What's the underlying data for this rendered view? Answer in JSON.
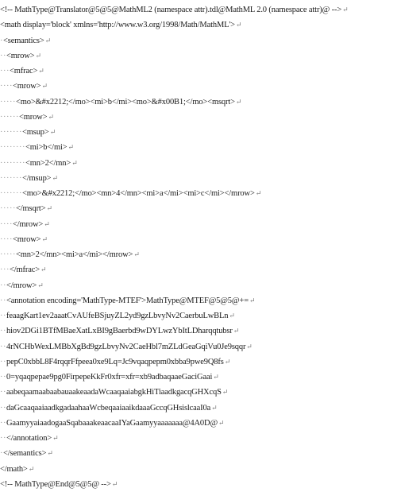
{
  "lines": [
    {
      "indent": "",
      "text": "<!-- MathType@Translator@5@5@MathML2 (namespace attr).tdl@MathML 2.0 (namespace attr)@ -->"
    },
    {
      "indent": "",
      "text": "<math display='block' xmlns='http://www.w3.org/1998/Math/MathML'>"
    },
    {
      "indent": "·",
      "text": "<semantics>"
    },
    {
      "indent": "··",
      "text": "<mrow>"
    },
    {
      "indent": "···",
      "text": "<mfrac>"
    },
    {
      "indent": "····",
      "text": "<mrow>"
    },
    {
      "indent": "·····",
      "text": "<mo>&#x2212;</mo><mi>b</mi><mo>&#x00B1;</mo><msqrt>"
    },
    {
      "indent": "······",
      "text": "<mrow>"
    },
    {
      "indent": "·······",
      "text": "<msup>"
    },
    {
      "indent": "········",
      "text": "<mi>b</mi>"
    },
    {
      "indent": "········",
      "text": "<mn>2</mn>"
    },
    {
      "indent": "·······",
      "text": "</msup>"
    },
    {
      "indent": "·······",
      "text": "<mo>&#x2212;</mo><mn>4</mn><mi>a</mi><mi>c</mi></mrow>"
    },
    {
      "indent": "·····",
      "text": "</msqrt>"
    },
    {
      "indent": "····",
      "text": "</mrow>"
    },
    {
      "indent": "····",
      "text": "<mrow>"
    },
    {
      "indent": "·····",
      "text": "<mn>2</mn><mi>a</mi></mrow>"
    },
    {
      "indent": "···",
      "text": "</mfrac>"
    },
    {
      "indent": "··",
      "text": "</mrow>"
    },
    {
      "indent": "··",
      "text": "<annotation encoding='MathType-MTEF'>MathType@MTEF@5@5@+="
    },
    {
      "indent": "··",
      "text": "feaagKart1ev2aaatCvAUfeBSjuyZL2yd9gzLbvyNv2CaerbuLwBLn"
    },
    {
      "indent": "··",
      "text": "hiov2DGi1BTfMBaeXatLxBI9gBaerbd9wDYLwzYbItLDharqqtubsr"
    },
    {
      "indent": "··",
      "text": "4rNCHbWexLMBbXgBd9gzLbvyNv2CaeHbl7mZLdGeaGqiVu0Je9sqqr"
    },
    {
      "indent": "··",
      "text": "pepC0xbbL8F4rqqrFfpeea0xe9Lq=Jc9vqaqpepm0xbba9pwe9Q8fs"
    },
    {
      "indent": "··",
      "text": "0=yqaqpepae9pg0FirpepeKkFr0xfr=xfr=xb9adbaqaaeGaciGaai"
    },
    {
      "indent": "··",
      "text": "aabeqaamaabaabauaakeaadaWcaaqaaiabgkHiTiaadkgacqGHXcqS"
    },
    {
      "indent": "··",
      "text": "daGcaaqaaiaadkgadaahaaWcbeqaaiaaikdaaaGccqGHsislcaaI0a"
    },
    {
      "indent": "··",
      "text": "GaamyyaiaadogaaSqabaaakeaacaaIYaGaamyyaaaaaaa@4A0D@"
    },
    {
      "indent": "··",
      "text": "</annotation>"
    },
    {
      "indent": "·",
      "text": "</semantics>"
    },
    {
      "indent": "",
      "text": "</math>"
    },
    {
      "indent": "",
      "text": "<!-- MathType@End@5@5@ -->"
    }
  ],
  "paragraph_mark": "↵"
}
